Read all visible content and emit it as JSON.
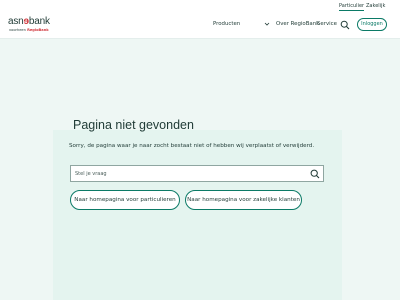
{
  "topbar": {
    "particulier": "Particulier",
    "zakelijk": "Zakelijk"
  },
  "logo": {
    "main_prefix": "asn",
    "main_suffix": "bank",
    "sub_prefix": "voorheen ",
    "sub_brand": "RegioBank"
  },
  "nav": {
    "products": "Producten",
    "over": "Over RegioBank",
    "service": "Service",
    "login": "Inloggen"
  },
  "main": {
    "title": "Pagina niet gevonden",
    "description": "Sorry, de pagina waar je naar zocht bestaat niet of hebben wij verplaatst of verwijderd.",
    "search_placeholder": "Stel je vraag",
    "buttons": [
      {
        "label": "Naar homepagina voor particulieren"
      },
      {
        "label": "Naar homepagina voor zakelijke klanten"
      }
    ]
  },
  "colors": {
    "accent": "#0b7a66",
    "brand_red": "#d0343a",
    "background": "#eef7f4"
  },
  "icons": [
    "search-icon",
    "chevron-down-icon"
  ]
}
